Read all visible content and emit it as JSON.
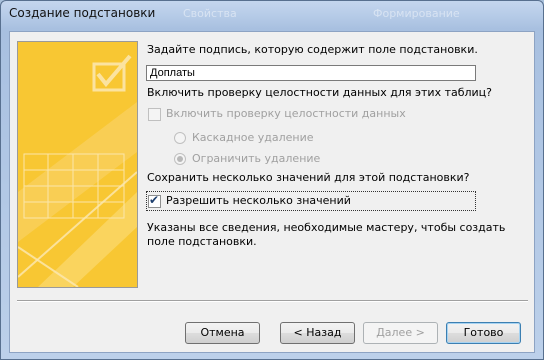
{
  "window": {
    "title": "Создание подстановки",
    "ghost_titles": [
      "Свойства",
      "Формирование"
    ]
  },
  "prompt_caption": "Задайте подпись, которую содержит поле подстановки.",
  "caption_input": {
    "value": "Доплаты"
  },
  "integrity_question": "Включить проверку целостности данных для этих таблиц?",
  "integrity_checkbox": {
    "label": "Включить проверку целостности данных",
    "checked": false,
    "enabled": false
  },
  "cascade_delete": {
    "label": "Каскадное удаление",
    "selected": false,
    "enabled": false
  },
  "restrict_delete": {
    "label": "Ограничить удаление",
    "selected": true,
    "enabled": false
  },
  "multivalue_question": "Сохранить несколько значений для этой подстановки?",
  "multivalue_checkbox": {
    "label": "Разрешить несколько значений",
    "checked": true
  },
  "finish_text_line1": "Указаны все сведения, необходимые мастеру, чтобы создать",
  "finish_text_line2": "поле подстановки.",
  "buttons": {
    "cancel": "Отмена",
    "back": "< Назад",
    "next": "Далее >",
    "finish": "Готово"
  },
  "colors": {
    "art_background": "#f8c733",
    "accent": "#3c7fb1"
  }
}
